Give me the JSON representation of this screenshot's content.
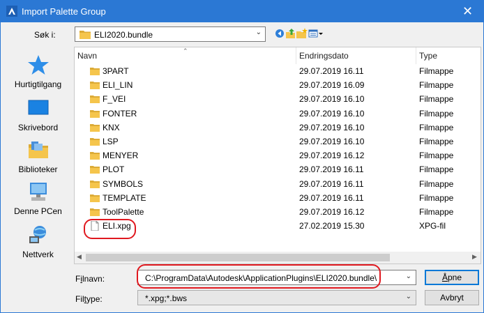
{
  "window": {
    "title": "Import Palette Group",
    "close_glyph": "✕"
  },
  "lookin": {
    "label": "Søk i:",
    "value": "ELI2020.bundle"
  },
  "toolbar_icons": [
    "back-icon",
    "up-folder-icon",
    "new-folder-icon",
    "view-menu-icon"
  ],
  "places": [
    {
      "label": "Hurtigtilgang",
      "icon": "star-icon"
    },
    {
      "label": "Skrivebord",
      "icon": "desktop-icon"
    },
    {
      "label": "Biblioteker",
      "icon": "library-icon"
    },
    {
      "label": "Denne PCen",
      "icon": "computer-icon"
    },
    {
      "label": "Nettverk",
      "icon": "network-icon"
    }
  ],
  "columns": {
    "name": "Navn",
    "date": "Endringsdato",
    "type": "Type"
  },
  "files": [
    {
      "name": "3PART",
      "date": "29.07.2019 16.11",
      "type": "Filmappe",
      "kind": "folder"
    },
    {
      "name": "ELI_LIN",
      "date": "29.07.2019 16.09",
      "type": "Filmappe",
      "kind": "folder"
    },
    {
      "name": "F_VEI",
      "date": "29.07.2019 16.10",
      "type": "Filmappe",
      "kind": "folder"
    },
    {
      "name": "FONTER",
      "date": "29.07.2019 16.10",
      "type": "Filmappe",
      "kind": "folder"
    },
    {
      "name": "KNX",
      "date": "29.07.2019 16.10",
      "type": "Filmappe",
      "kind": "folder"
    },
    {
      "name": "LSP",
      "date": "29.07.2019 16.10",
      "type": "Filmappe",
      "kind": "folder"
    },
    {
      "name": "MENYER",
      "date": "29.07.2019 16.12",
      "type": "Filmappe",
      "kind": "folder"
    },
    {
      "name": "PLOT",
      "date": "29.07.2019 16.11",
      "type": "Filmappe",
      "kind": "folder"
    },
    {
      "name": "SYMBOLS",
      "date": "29.07.2019 16.11",
      "type": "Filmappe",
      "kind": "folder"
    },
    {
      "name": "TEMPLATE",
      "date": "29.07.2019 16.11",
      "type": "Filmappe",
      "kind": "folder"
    },
    {
      "name": "ToolPalette",
      "date": "29.07.2019 16.12",
      "type": "Filmappe",
      "kind": "folder"
    },
    {
      "name": "ELI.xpg",
      "date": "27.02.2019 15.30",
      "type": "XPG-fil",
      "kind": "file"
    }
  ],
  "filename": {
    "label_pre": "F",
    "label_accel": "i",
    "label_post": "lnavn:",
    "value": "C:\\ProgramData\\Autodesk\\ApplicationPlugins\\ELI2020.bundle\\"
  },
  "filetype": {
    "label_pre": "Fil",
    "label_accel": "t",
    "label_post": "ype:",
    "value": "*.xpg;*.bws"
  },
  "buttons": {
    "open_pre": "",
    "open_accel": "Å",
    "open_post": "pne",
    "cancel": "Avbryt"
  },
  "colors": {
    "titlebar": "#2b78d4",
    "folder": "#f5c54c",
    "highlight": "#e0181f",
    "default_button": "#0078d7"
  }
}
